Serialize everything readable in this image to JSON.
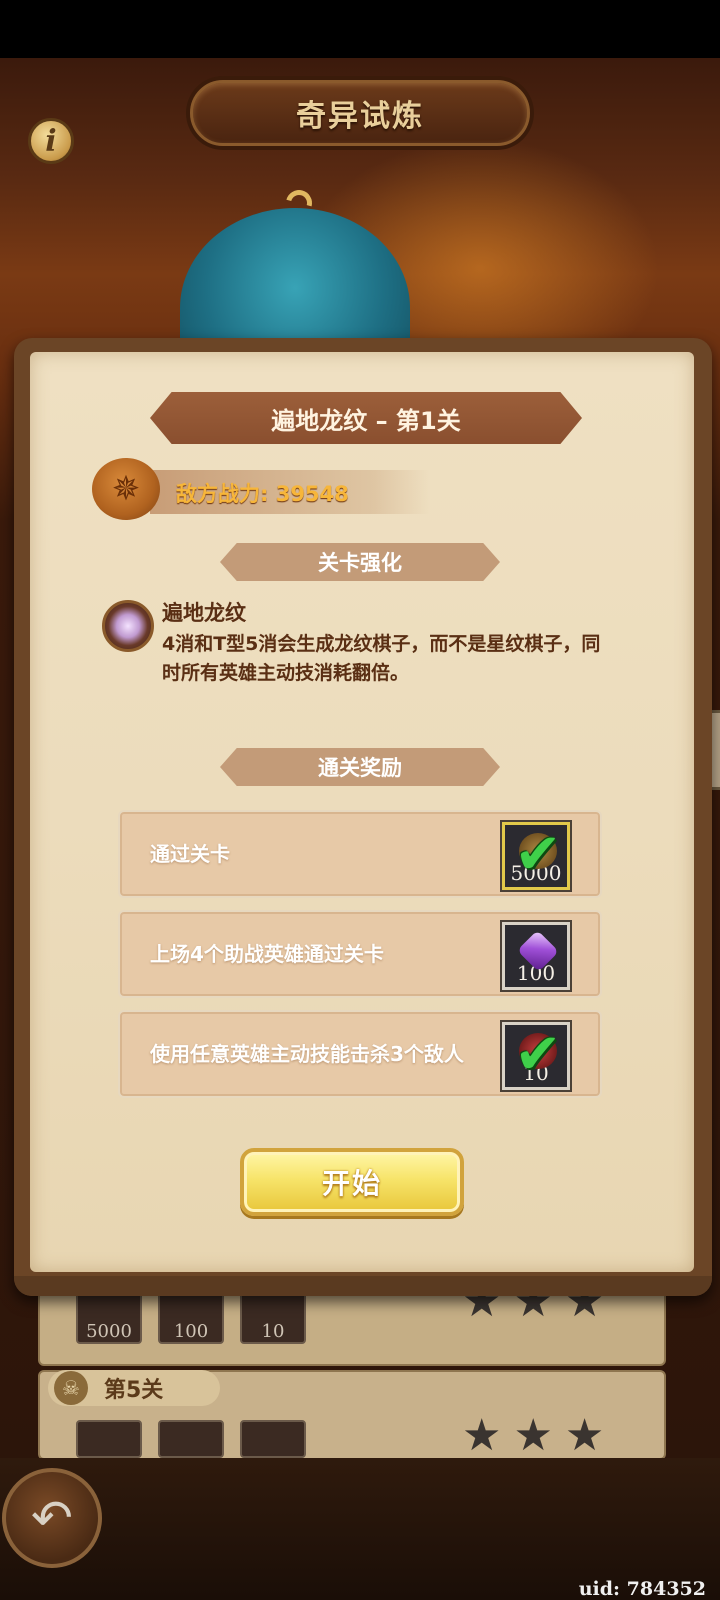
{
  "header": {
    "title": "奇异试炼"
  },
  "dialog": {
    "stage_title": "遍地龙纹 – 第1关",
    "enemy_power": "敌方战力: 39548",
    "enhance_tab": "关卡强化",
    "modifier": {
      "title": "遍地龙纹",
      "description": "4消和T型5消会生成龙纹棋子，而不是星纹棋子，同时所有英雄主动技消耗翻倍。"
    },
    "rewards_tab": "通关奖励",
    "rewards": [
      {
        "text": "通过关卡",
        "item": "coin-icon",
        "qty": "5000",
        "completed": true
      },
      {
        "text": "上场4个助战英雄通过关卡",
        "item": "gem-icon",
        "qty": "100",
        "completed": false
      },
      {
        "text": "使用任意英雄主动技能击杀3个敌人",
        "item": "ruby-icon",
        "qty": "10",
        "completed": true
      }
    ],
    "start_label": "开始"
  },
  "background_list": {
    "row1_rewards": [
      "5000",
      "100",
      "10"
    ],
    "row2_label": "第5关"
  },
  "footer": {
    "uid": "uid: 784352"
  },
  "colors": {
    "accent_gold": "#f7e46a",
    "enemy_power": "#f7b63a",
    "check_green": "#3fd04a"
  }
}
